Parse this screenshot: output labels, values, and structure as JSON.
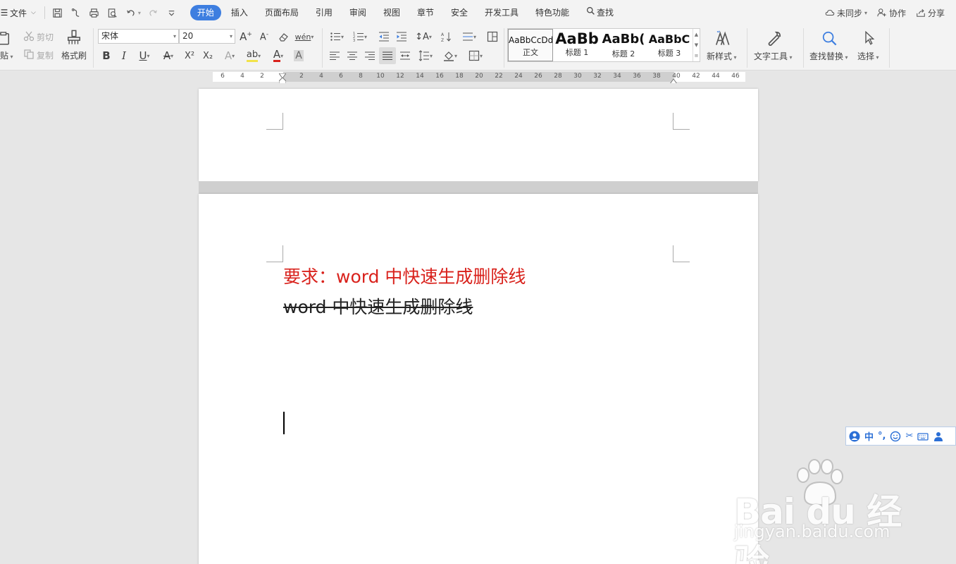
{
  "menubar": {
    "file_label": "文件",
    "tabs": [
      {
        "label": "开始",
        "active": true
      },
      {
        "label": "插入"
      },
      {
        "label": "页面布局"
      },
      {
        "label": "引用"
      },
      {
        "label": "审阅"
      },
      {
        "label": "视图"
      },
      {
        "label": "章节"
      },
      {
        "label": "安全"
      },
      {
        "label": "开发工具"
      },
      {
        "label": "特色功能"
      },
      {
        "label": "查找"
      }
    ],
    "right": {
      "sync_label": "未同步",
      "collab_label": "协作",
      "share_label": "分享"
    },
    "accent_color": "#3d7ee0"
  },
  "ribbon": {
    "paste_label": "贴",
    "cut_label": "剪切",
    "copy_label": "复制",
    "format_painter_label": "格式刷",
    "font_name": "宋体",
    "font_size": "20",
    "bold": "B",
    "italic": "I",
    "underline": "U",
    "text_effect": "A",
    "superscript": "X²",
    "subscript": "X₂",
    "styles": [
      {
        "sample": "AaBbCcDd",
        "name": "正文"
      },
      {
        "sample": "AaBb",
        "name": "标题 1"
      },
      {
        "sample": "AaBb(",
        "name": "标题 2"
      },
      {
        "sample": "AaBbC",
        "name": "标题 3"
      }
    ],
    "new_style_label": "新样式",
    "text_tools_label": "文字工具",
    "find_replace_label": "查找替换",
    "select_label": "选择"
  },
  "ruler": {
    "ticks": [
      "6",
      "4",
      "2",
      "2",
      "4",
      "6",
      "8",
      "10",
      "12",
      "14",
      "16",
      "18",
      "20",
      "22",
      "24",
      "26",
      "28",
      "30",
      "32",
      "34",
      "36",
      "38",
      "40",
      "42",
      "44",
      "46"
    ]
  },
  "document": {
    "line1": "要求：word 中快速生成删除线",
    "line2": "word 中快速生成删除线",
    "line1_color": "#d9221c"
  },
  "ime": {
    "mode": "中"
  },
  "watermark": {
    "brand": "Bai du 经验",
    "url": "jingyan.baidu.com"
  }
}
